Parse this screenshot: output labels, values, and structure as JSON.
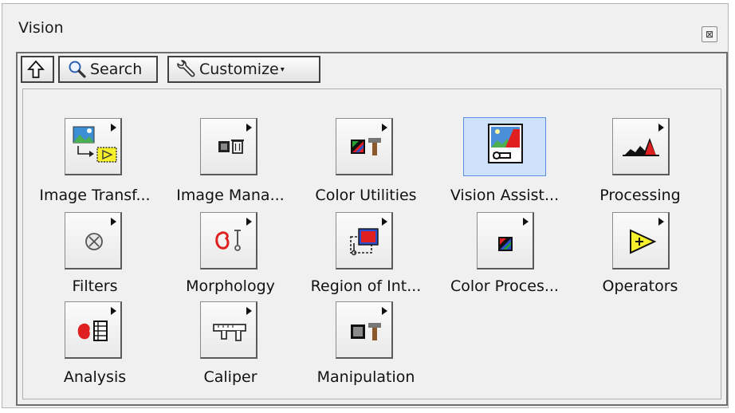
{
  "window": {
    "title": "Vision",
    "close_glyph": "⊠"
  },
  "toolbar": {
    "up_icon": "up-arrow-icon",
    "search_label": "Search",
    "customize_label": "Customize",
    "customize_caret": "▾"
  },
  "palette": {
    "items": [
      {
        "label": "Image Transf...",
        "icon": "image-transfer-icon"
      },
      {
        "label": "Image Mana...",
        "icon": "image-management-icon"
      },
      {
        "label": "Color Utilities",
        "icon": "color-utilities-icon"
      },
      {
        "label": "Vision Assist...",
        "icon": "vision-assistant-icon",
        "selected": true
      },
      {
        "label": "Processing",
        "icon": "processing-icon"
      },
      {
        "label": "Filters",
        "icon": "filters-icon"
      },
      {
        "label": "Morphology",
        "icon": "morphology-icon"
      },
      {
        "label": "Region of Int...",
        "icon": "region-of-interest-icon"
      },
      {
        "label": "Color Proces...",
        "icon": "color-processing-icon"
      },
      {
        "label": "Operators",
        "icon": "operators-icon"
      },
      {
        "label": "Analysis",
        "icon": "analysis-icon"
      },
      {
        "label": "Caliper",
        "icon": "caliper-icon"
      },
      {
        "label": "Manipulation",
        "icon": "manipulation-icon"
      }
    ]
  },
  "colors": {
    "selection": "#cfe2fb",
    "selection_border": "#5b8fe0",
    "red_accent": "#e02020",
    "yellow_accent": "#f6ef2c"
  }
}
